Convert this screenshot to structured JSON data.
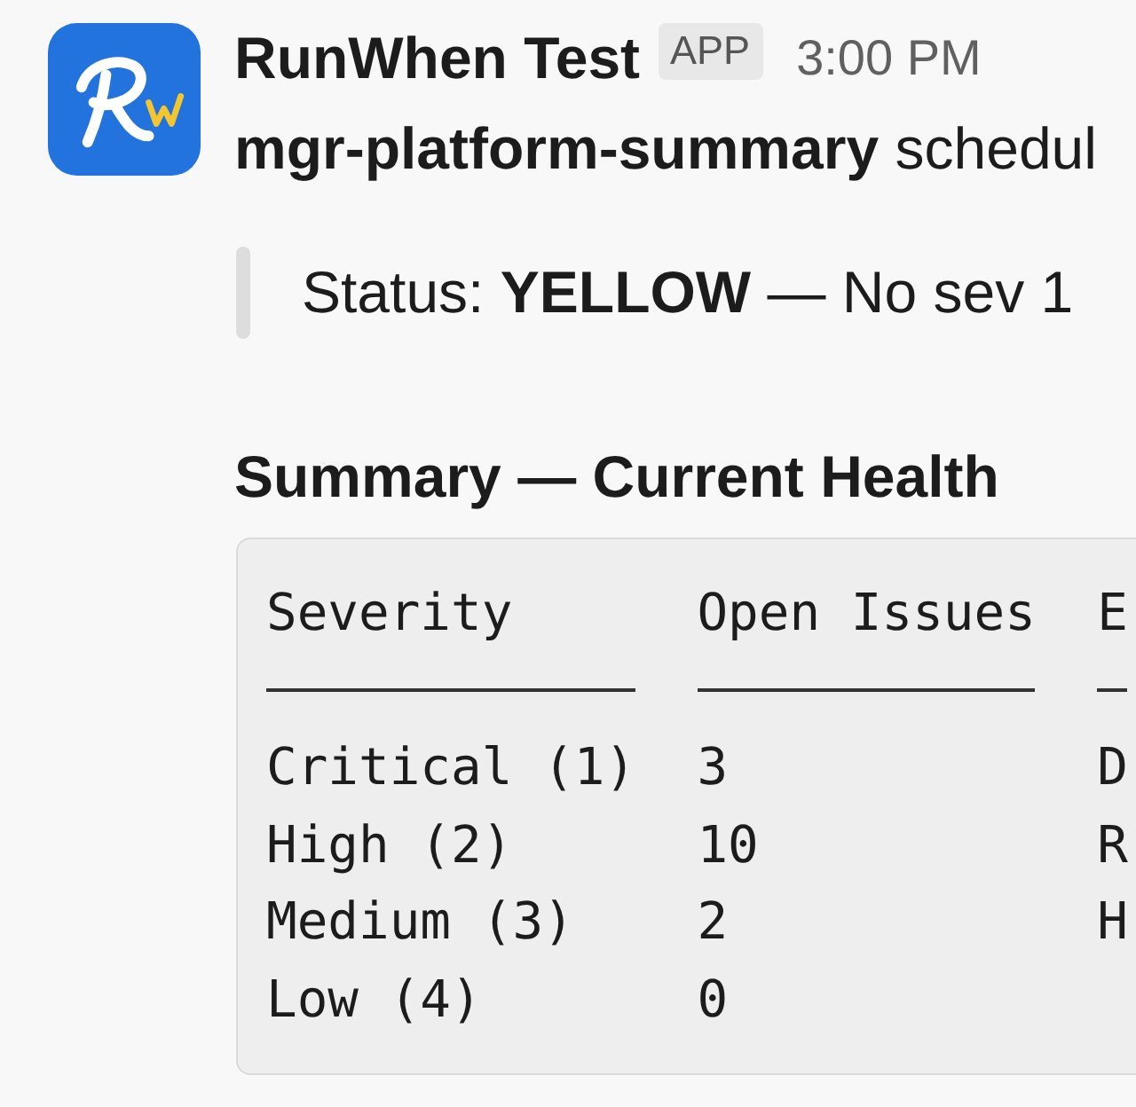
{
  "message": {
    "sender": "RunWhen Test",
    "badge": "APP",
    "time": "3:00 PM",
    "body": "**mgr-platform-summary** schedul",
    "quote": "Status: **YELLOW** — No sev 1",
    "heading": "Summary — Current Health",
    "code_block": {
      "columns": [
        "Severity",
        "Open Issues",
        "E"
      ],
      "rows": [
        [
          "Critical (1)",
          "3",
          "D"
        ],
        [
          "High (2)",
          "10",
          "R"
        ],
        [
          "Medium (3)",
          "2",
          "H"
        ],
        [
          "Low (4)",
          "0"
        ]
      ]
    }
  }
}
